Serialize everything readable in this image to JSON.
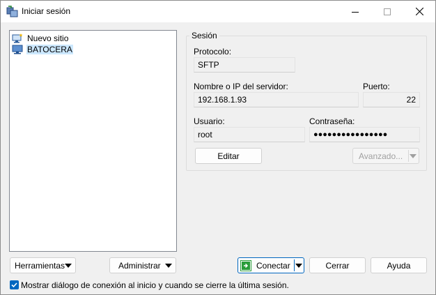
{
  "window": {
    "title": "Iniciar sesión",
    "icon": "winscp-icon",
    "controls": [
      "minimize-icon",
      "maximize-icon",
      "close-icon"
    ]
  },
  "tree": {
    "items": [
      {
        "label": "Nuevo sitio",
        "icon": "new-site-icon",
        "selected": false
      },
      {
        "label": "BATOCERA",
        "icon": "monitor-icon",
        "selected": true
      }
    ]
  },
  "session": {
    "group_title": "Sesión",
    "protocol_label": "Protocolo:",
    "protocol_value": "SFTP",
    "host_label": "Nombre o IP del servidor:",
    "host_value": "192.168.1.93",
    "port_label": "Puerto:",
    "port_value": "22",
    "user_label": "Usuario:",
    "user_value": "root",
    "password_label": "Contraseña:",
    "password_value": "●●●●●●●●●●●●●●●●",
    "edit_label": "Editar",
    "advanced_label": "Avanzado..."
  },
  "footer": {
    "tools_label": "Herramientas",
    "manage_label": "Administrar",
    "connect_label": "Conectar",
    "close_label": "Cerrar",
    "help_label": "Ayuda",
    "checkbox_label": "Mostrar diálogo de conexión al inicio y cuando se cierre la última sesión.",
    "checkbox_checked": true
  },
  "colors": {
    "accent": "#0067c0",
    "selection": "#cce8ff",
    "connect_icon": "#2a9d3a"
  }
}
